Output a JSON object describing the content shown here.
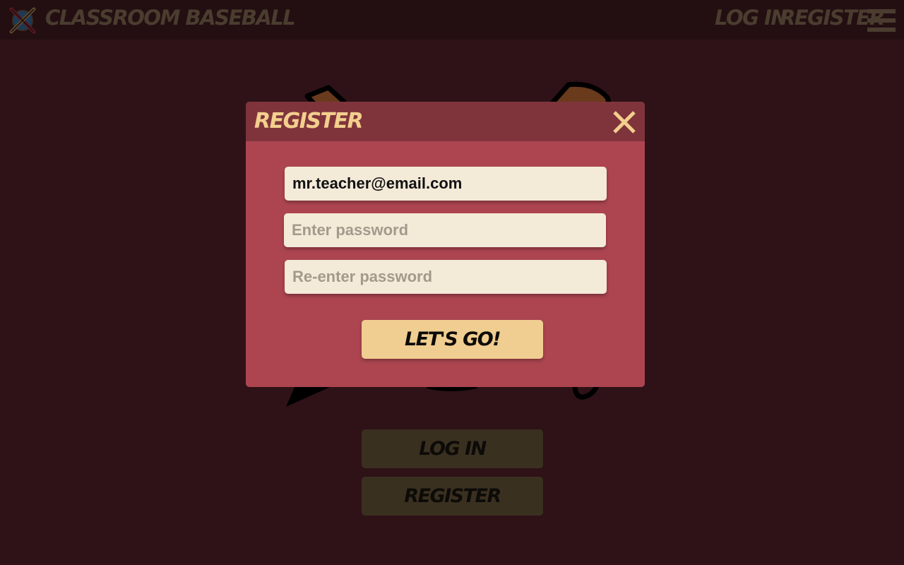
{
  "header": {
    "brand": "Classroom Baseball",
    "login_link": "Log In",
    "register_link": "Register",
    "menu_icon": "hamburger-menu-icon",
    "logo_icon": "crossed-bats-ball-logo"
  },
  "background": {
    "login_button": "Log In",
    "register_button": "Register"
  },
  "modal": {
    "title": "Register",
    "close_icon": "close-icon",
    "email_value": "mr.teacher@email.com",
    "password_placeholder": "Enter password",
    "repassword_placeholder": "Re-enter password",
    "submit_label": "Let's Go!"
  },
  "colors": {
    "background": "#2e1217",
    "topbar": "#230f12",
    "modal_body": "#ac4550",
    "modal_header": "#7f343b",
    "accent": "#f0cd90",
    "input": "#f4ead8"
  }
}
